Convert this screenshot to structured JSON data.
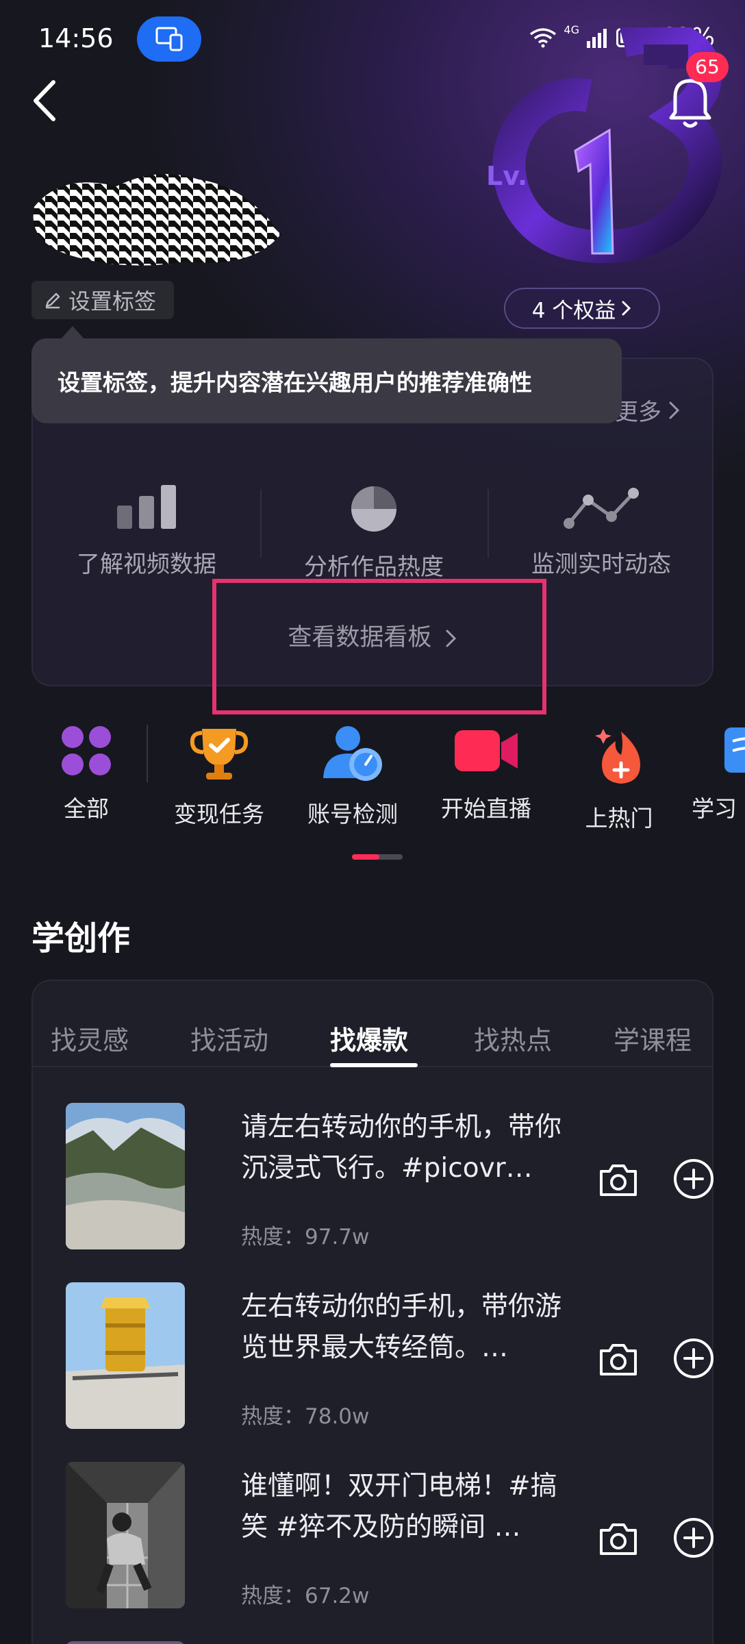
{
  "status_bar": {
    "time": "14:56",
    "network": "4G",
    "battery_percent": "62%",
    "battery_level": 0.62
  },
  "header": {
    "notification_count": "65",
    "level_text": "Lv.",
    "level_number": "1",
    "set_tag_label": "设置标签",
    "rights_label": "4 个权益"
  },
  "tooltip": {
    "text": "设置标签，提升内容潜在兴趣用户的推荐准确性"
  },
  "data_card": {
    "more_label": "更多",
    "features": [
      {
        "label": "了解视频数据",
        "icon": "bar-chart-icon"
      },
      {
        "label": "分析作品热度",
        "icon": "pie-chart-icon"
      },
      {
        "label": "监测实时动态",
        "icon": "line-trend-icon"
      }
    ],
    "dashboard_link": "查看数据看板"
  },
  "shortcuts": [
    {
      "label": "全部",
      "icon": "grid-dots-icon"
    },
    {
      "label": "变现任务",
      "icon": "trophy-icon"
    },
    {
      "label": "账号检测",
      "icon": "account-check-icon"
    },
    {
      "label": "开始直播",
      "icon": "video-camera-icon"
    },
    {
      "label": "上热门",
      "icon": "flame-plus-icon"
    },
    {
      "label": "学习",
      "icon": "book-icon"
    }
  ],
  "section_title": "学创作",
  "learn": {
    "tabs": [
      "找灵感",
      "找活动",
      "找爆款",
      "找热点",
      "学课程"
    ],
    "active_tab": "找爆款",
    "videos": [
      {
        "title": "请左右转动你的手机，带你沉浸式飞行。#picovr…",
        "heat": "热度：97.7w"
      },
      {
        "title": "左右转动你的手机，带你游览世界最大转经筒。…",
        "heat": "热度：78.0w"
      },
      {
        "title": "谁懂啊！双开门电梯！#搞笑 #猝不及防的瞬间 …",
        "heat": "热度：67.2w"
      }
    ]
  },
  "colors": {
    "accent": "#fe2c55",
    "highlight_box": "#e5336f",
    "tooltip_bg": "#3b3a44",
    "cast_pill": "#1f6cf5"
  }
}
